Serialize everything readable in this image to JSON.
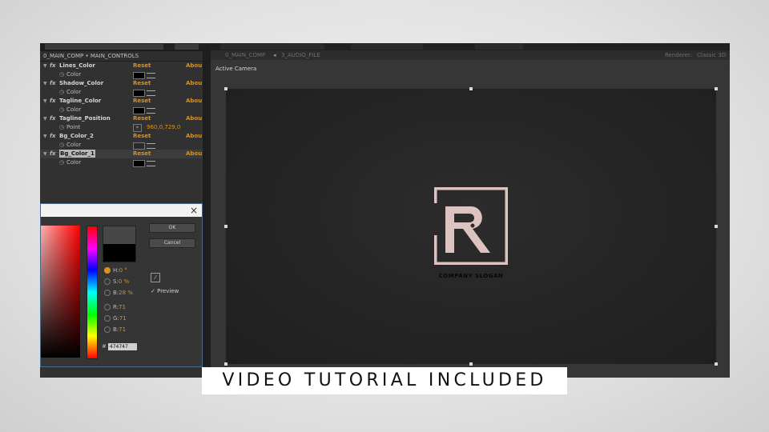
{
  "left_panel": {
    "breadcrumb": "0_MAIN_COMP • MAIN_CONTROLS",
    "reset_label": "Reset",
    "about_label": "Abou",
    "effects": [
      {
        "name": "Lines_Color",
        "param": "Color",
        "swatch": "#000000"
      },
      {
        "name": "Shadow_Color",
        "param": "Color",
        "swatch": "#000000"
      },
      {
        "name": "Tagline_Color",
        "param": "Color",
        "swatch": "#000000"
      },
      {
        "name": "Tagline_Position",
        "param": "Point",
        "value": "960,0,729,0"
      },
      {
        "name": "Bg_Color_2",
        "param": "Color",
        "swatch": "#2a2a2a"
      },
      {
        "name": "Bg_Color_1",
        "param": "Color",
        "swatch": "#000000",
        "selected": true
      }
    ]
  },
  "comp_panel": {
    "tabs": [
      "0_MAIN_COMP",
      "3_AUDIO_FILE"
    ],
    "renderer_label": "Renderer:",
    "renderer_value": "Classic 3D",
    "camera_label": "Active Camera",
    "slogan": "COMPANY SLOGAN",
    "logo_color": "#dcc3c0"
  },
  "color_picker": {
    "ok_label": "OK",
    "cancel_label": "Cancel",
    "preview_label": "Preview",
    "close_glyph": "×",
    "new_color": "#474747",
    "original_color": "#000000",
    "hsb": [
      {
        "label": "H:",
        "value": "0 °",
        "selected": true
      },
      {
        "label": "S:",
        "value": "0 %",
        "selected": false
      },
      {
        "label": "B:",
        "value": "28 %",
        "selected": false
      }
    ],
    "rgb": [
      {
        "label": "R:",
        "value": "71"
      },
      {
        "label": "G:",
        "value": "71"
      },
      {
        "label": "B:",
        "value": "71"
      }
    ],
    "hex_prefix": "#",
    "hex_value": "474747"
  },
  "banner": {
    "text": "VIDEO TUTORIAL INCLUDED"
  },
  "icons": [
    "expand-triangle-icon",
    "fx-icon",
    "stopwatch-icon",
    "eyedropper-icon",
    "crosshair-icon",
    "close-icon",
    "logo-r-mark"
  ]
}
